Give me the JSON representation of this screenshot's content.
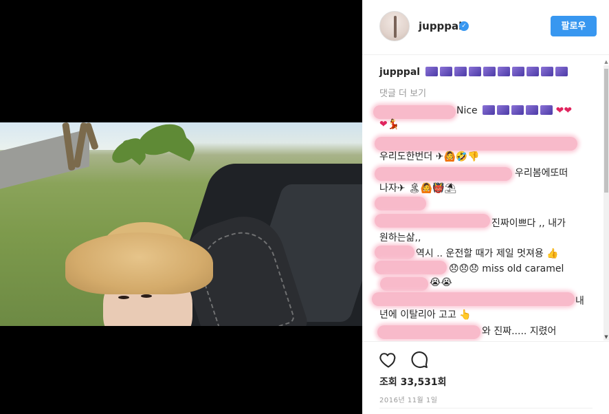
{
  "post": {
    "username": "jupppal",
    "verified_mark": "✓",
    "follow_label": "팔로우"
  },
  "caption": {
    "username": "jupppal",
    "icons": [
      "music-note-emoji",
      "music-note-emoji",
      "music-note-emoji",
      "music-note-emoji",
      "music-note-emoji",
      "music-note-emoji",
      "music-note-emoji",
      "music-note-emoji",
      "music-note-emoji",
      "music-note-emoji"
    ]
  },
  "comments": {
    "load_more": "댓글 더 보기",
    "items": [
      {
        "text": "Nice"
      },
      {
        "text": "우리도한번더"
      },
      {
        "text": "우리봄에또떠"
      },
      {
        "text": "나자✈"
      },
      {
        "text": "진짜이쁘다 ,, 내가"
      },
      {
        "text": "원하는삶,,"
      },
      {
        "text": "역시 .. 운전할 때가 제일 멋져용"
      },
      {
        "text": "miss old caramel"
      },
      {
        "text": "내"
      },
      {
        "text": "년에 이탈리아 고고"
      },
      {
        "text": "와 진짜..... 지렸어"
      }
    ]
  },
  "stats": {
    "views_label": "조회",
    "views_count": "33,531회",
    "date": "2016년 11월 1일"
  },
  "icons": {
    "like": "heart-outline-icon",
    "comment": "speech-bubble-icon"
  },
  "colors": {
    "accent": "#3897f0",
    "redaction": "#f8b7c8",
    "text": "#262626",
    "muted": "#999999"
  }
}
